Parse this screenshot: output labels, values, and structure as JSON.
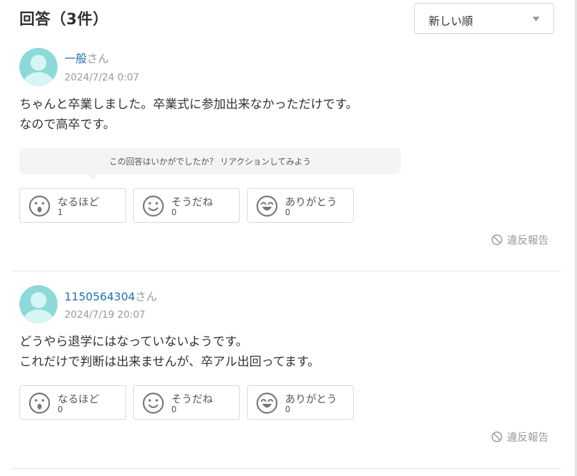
{
  "header": {
    "title": "回答（3件）"
  },
  "sort": {
    "selected": "新しい順"
  },
  "reaction_prompt": "この回答はいかがでしたか？ リアクションしてみよう",
  "reaction_labels": {
    "naruhodo": "なるほど",
    "soudane": "そうだね",
    "arigatou": "ありがとう"
  },
  "report_label": "違反報告",
  "answers": [
    {
      "user": "一般",
      "user_suffix": "さん",
      "date": "2024/7/24 0:07",
      "text_line1": "ちゃんと卒業しました。卒業式に参加出来なかっただけです。",
      "text_line2": "なので高卒です。",
      "reactions": {
        "naruhodo": "1",
        "soudane": "0",
        "arigatou": "0"
      }
    },
    {
      "user": "1150564304",
      "user_suffix": "さん",
      "date": "2024/7/19 20:07",
      "text_line1": "どうやら退学にはなっていないようです。",
      "text_line2": "これだけで判断は出来ませんが、卒アル出回ってます。",
      "reactions": {
        "naruhodo": "0",
        "soudane": "0",
        "arigatou": "0"
      }
    }
  ],
  "colors": {
    "accent_link": "#1f6fb0",
    "avatar": "#8dd9d8",
    "muted": "#999999"
  }
}
